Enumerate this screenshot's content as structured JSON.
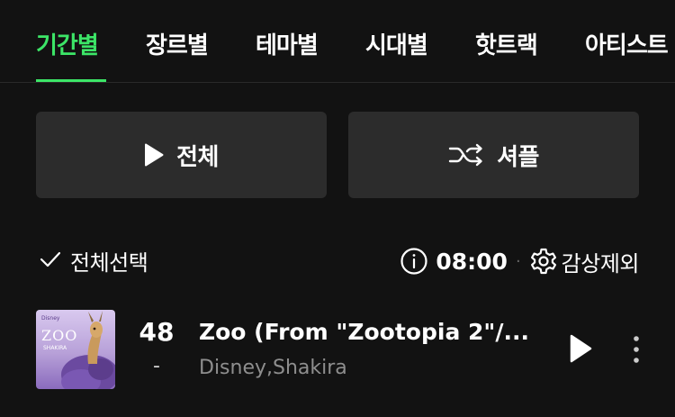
{
  "tabs": [
    {
      "label": "기간별",
      "active": true
    },
    {
      "label": "장르별",
      "active": false
    },
    {
      "label": "테마별",
      "active": false
    },
    {
      "label": "시대별",
      "active": false
    },
    {
      "label": "핫트랙",
      "active": false
    },
    {
      "label": "아티스트",
      "active": false
    }
  ],
  "actions": {
    "play_all_label": "전체",
    "shuffle_label": "셔플"
  },
  "toolbar": {
    "select_all_label": "전체선택",
    "total_duration": "08:00",
    "separator": "·",
    "exclude_label": "감상제외"
  },
  "tracks": [
    {
      "rank": "48",
      "rank_change": "-",
      "title": "Zoo (From \"Zootopia 2\"/...",
      "artist": "Disney,Shakira",
      "album_art_text": {
        "brand": "Disney",
        "title": "ZOO",
        "artist": "SHAKIRA"
      }
    }
  ],
  "colors": {
    "background": "#121212",
    "accent": "#3ce567",
    "button_bg": "#2c2c2c",
    "secondary_text": "#8e8e8e"
  },
  "icons": {
    "play": "play-icon",
    "shuffle": "shuffle-icon",
    "check": "check-icon",
    "info": "info-icon",
    "gear": "gear-icon",
    "more": "more-vertical-icon"
  }
}
